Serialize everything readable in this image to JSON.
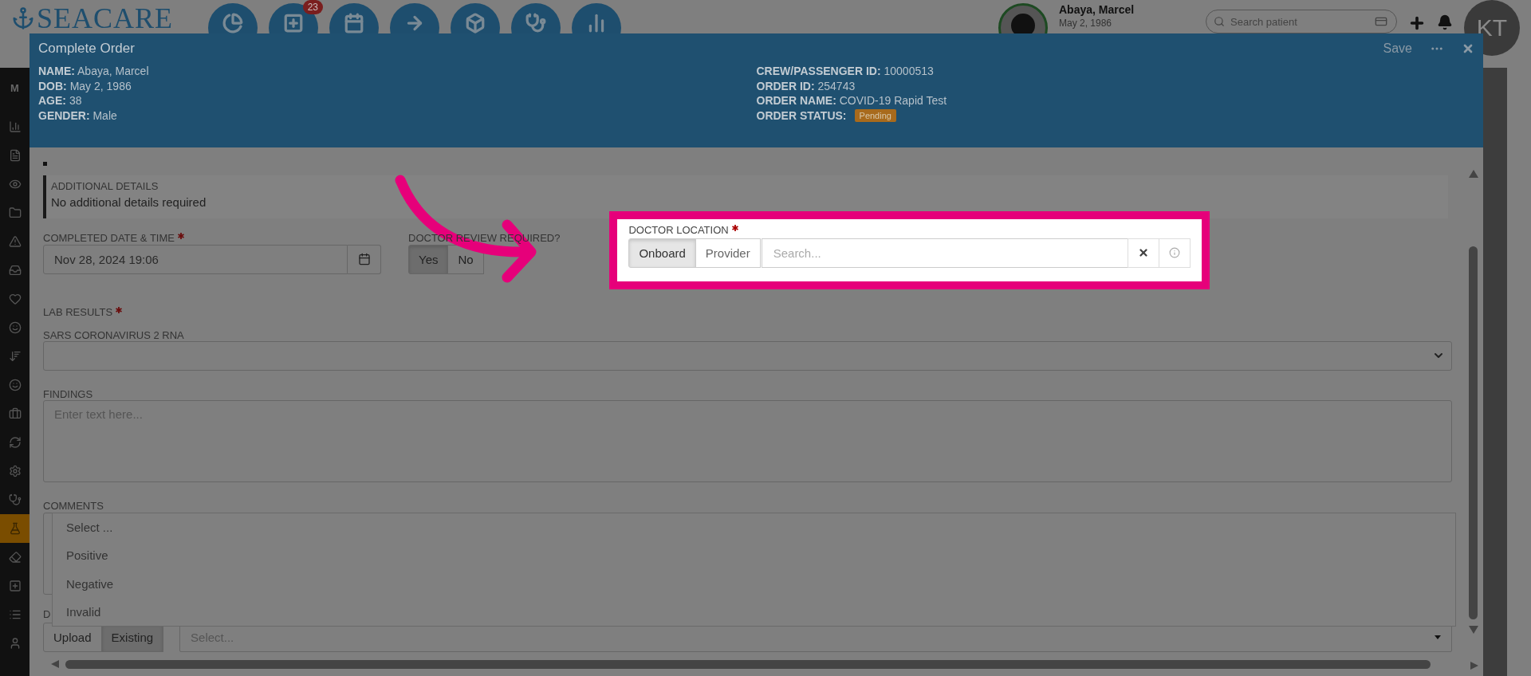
{
  "app": {
    "logo": "SEACARE",
    "sidebar_heading": "M",
    "nav_badge": "23",
    "patient": {
      "name": "Abaya, Marcel",
      "dob": "May 2, 1986"
    },
    "search": {
      "placeholder": "Search patient"
    },
    "avatar": "KT",
    "sidebar_items": [
      {
        "selected": false
      },
      {
        "selected": false
      },
      {
        "selected": false
      },
      {
        "selected": false
      },
      {
        "selected": false
      },
      {
        "selected": false
      },
      {
        "selected": false
      },
      {
        "selected": false
      },
      {
        "selected": false
      },
      {
        "selected": false
      },
      {
        "selected": false
      },
      {
        "selected": false
      },
      {
        "selected": false
      },
      {
        "selected": false
      },
      {
        "selected": true
      },
      {
        "selected": false
      },
      {
        "selected": false
      },
      {
        "selected": false
      },
      {
        "selected": false
      }
    ]
  },
  "modal": {
    "title": "Complete Order",
    "save": "Save",
    "patient_info": [
      "**NAME:** Abaya, Marcel",
      "**DOB:** May 2, 1986",
      "**AGE:** 38",
      "**GENDER:** Male"
    ],
    "order_info": [
      "**CREW/PASSENGER ID:** 10000513",
      "**ORDER ID:** 254743",
      "**ORDER NAME:** COVID-19 Rapid Test"
    ],
    "order_status": {
      "label": "ORDER STATUS:",
      "value": "Pending"
    },
    "additional_details": {
      "heading": "ADDITIONAL DETAILS",
      "text": "No additional details required"
    },
    "completed": {
      "label": "COMPLETED DATE & TIME",
      "required": true,
      "value": "Nov 28, 2024 19:06"
    },
    "doctor_review": {
      "label": "DOCTOR REVIEW REQUIRED?",
      "options": [
        {
          "label": "Yes",
          "selected": true
        },
        {
          "label": "No",
          "selected": false
        }
      ]
    },
    "doctor_location": {
      "label": "DOCTOR LOCATION",
      "required": true,
      "options": [
        {
          "label": "Onboard",
          "selected": true
        },
        {
          "label": "Provider",
          "selected": false
        }
      ],
      "placeholder": "Search..."
    },
    "lab_results": {
      "label": "LAB RESULTS",
      "required": true
    },
    "sars": {
      "label": "SARS CORONAVIRUS 2 RNA",
      "options": [
        "Select ...",
        "Positive",
        "Negative",
        "Invalid"
      ]
    },
    "findings": {
      "label": "FINDINGS",
      "placeholder": "Enter text here..."
    },
    "comments": {
      "label": "COMMENTS"
    },
    "documents": {
      "label": "D",
      "options": [
        {
          "label": "Upload",
          "selected": false
        },
        {
          "label": "Existing",
          "selected": true
        }
      ],
      "placeholder": "Select..."
    }
  }
}
